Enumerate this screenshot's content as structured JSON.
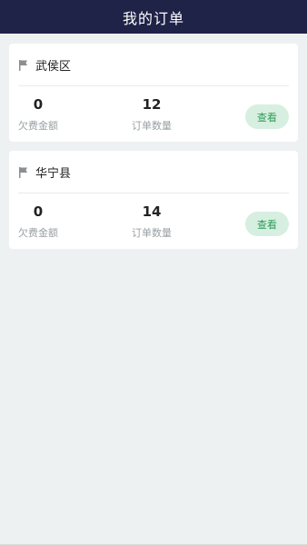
{
  "header": {
    "title": "我的订单"
  },
  "orders": [
    {
      "region": "武侯区",
      "debt_amount": "0",
      "debt_label": "欠费金额",
      "order_count": "12",
      "count_label": "订单数量",
      "button_label": "查看"
    },
    {
      "region": "华宁县",
      "debt_amount": "0",
      "debt_label": "欠费金额",
      "order_count": "14",
      "count_label": "订单数量",
      "button_label": "查看"
    }
  ],
  "colors": {
    "header_bg": "#1f2347",
    "page_bg": "#eef1f2",
    "button_bg": "#d7efe0",
    "button_text": "#2e9b5a"
  }
}
